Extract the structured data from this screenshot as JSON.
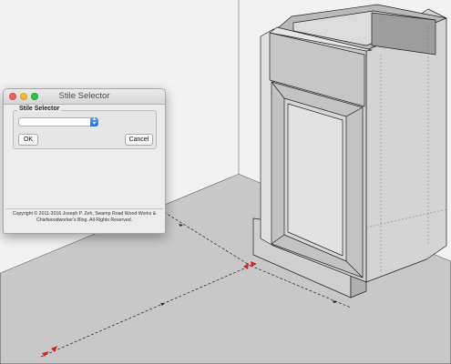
{
  "dialog": {
    "title": "Stile Selector",
    "group_label": "Stile Selector",
    "select_value": "",
    "ok_label": "OK",
    "cancel_label": "Cancel",
    "copyright": "Copyright © 2011-2016 Joseph P. Zeh, Swamp Road Wood Works & Chiefwoodworker's Blog. All Rights Reserved."
  },
  "icons": {
    "close": "window-close-icon",
    "minimize": "window-minimize-icon",
    "zoom": "window-zoom-icon",
    "dropdown": "chevron-updown-icon"
  },
  "colors": {
    "close": "#fc5f57",
    "minimize": "#fdbc2e",
    "zoom": "#2ac841",
    "accent": "#1f6fe6",
    "dimension_arrow": "#e02020"
  }
}
